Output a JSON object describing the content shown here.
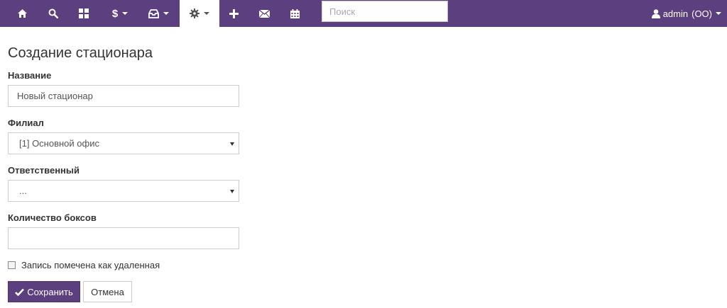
{
  "navbar": {
    "items": [
      {
        "name": "home",
        "icon": "home-icon",
        "dropdown": false,
        "active": false
      },
      {
        "name": "search",
        "icon": "search-icon",
        "dropdown": false,
        "active": false
      },
      {
        "name": "grid",
        "icon": "th-large-icon",
        "dropdown": false,
        "active": false
      },
      {
        "name": "finance",
        "icon": "dollar-icon",
        "label": "$",
        "dropdown": true,
        "active": false
      },
      {
        "name": "inbox",
        "icon": "inbox-icon",
        "dropdown": true,
        "active": false
      },
      {
        "name": "settings",
        "icon": "gear-icon",
        "dropdown": true,
        "active": true
      },
      {
        "name": "add",
        "icon": "plus-icon",
        "dropdown": false,
        "active": false
      },
      {
        "name": "mail",
        "icon": "envelope-icon",
        "dropdown": false,
        "active": false
      },
      {
        "name": "calendar",
        "icon": "calendar-icon",
        "dropdown": false,
        "active": false
      }
    ],
    "finance_label": "$",
    "search_placeholder": "Поиск",
    "user": {
      "name": "admin",
      "org": "(OO)",
      "icon": "user-icon"
    },
    "colors": {
      "background": "#5c3f7f",
      "active_background": "#ffffff",
      "text": "#ffffff"
    }
  },
  "form": {
    "title": "Создание стационара",
    "name_label": "Название",
    "name_value": "Новый стационар",
    "branch_label": "Филиал",
    "branch_value": "[1] Основной офис",
    "responsible_label": "Ответственный",
    "responsible_value": "...",
    "boxes_label": "Количество боксов",
    "boxes_value": "",
    "deleted_label": "Запись помечена как удаленная",
    "deleted_checked": false,
    "save_label": "Сохранить",
    "save_icon": "check-icon",
    "cancel_label": "Отмена",
    "colors": {
      "primary_button": "#5c3f7f"
    }
  }
}
